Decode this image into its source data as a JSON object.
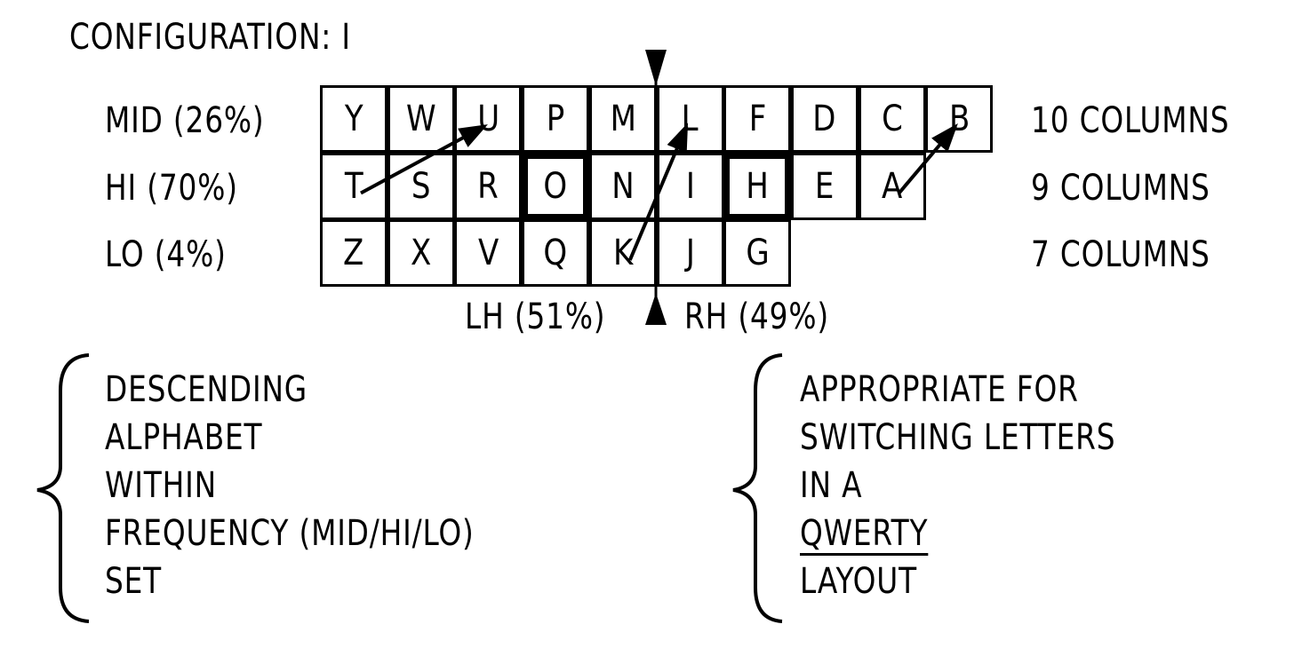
{
  "title": "CONFIGURATION: I",
  "rows": [
    {
      "label": "MID (26%)",
      "columns_label": "10 COLUMNS",
      "keys": [
        "Y",
        "W",
        "U",
        "P",
        "M",
        "L",
        "F",
        "D",
        "C",
        "B"
      ]
    },
    {
      "label": "HI (70%)",
      "columns_label": "9 COLUMNS",
      "keys": [
        "T",
        "S",
        "R",
        "O",
        "N",
        "I",
        "H",
        "E",
        "A"
      ]
    },
    {
      "label": "LO (4%)",
      "columns_label": "7 COLUMNS",
      "keys": [
        "Z",
        "X",
        "V",
        "Q",
        "K",
        "J",
        "G"
      ]
    }
  ],
  "highlighted_keys": [
    "O",
    "H"
  ],
  "swap_arrows": [
    {
      "from": "T",
      "to": "U"
    },
    {
      "from": "K",
      "to": "L"
    },
    {
      "from": "A",
      "to": "B"
    }
  ],
  "hand_split": {
    "left_label": "LH (51%)",
    "right_label": "RH (49%)"
  },
  "notes": {
    "left": [
      "DESCENDING",
      "ALPHABET",
      "WITHIN",
      "FREQUENCY (MID/HI/LO)",
      "SET"
    ],
    "right": [
      "APPROPRIATE FOR",
      "SWITCHING LETTERS",
      "IN A",
      "QWERTY",
      "LAYOUT"
    ],
    "right_underlined": "QWERTY"
  }
}
